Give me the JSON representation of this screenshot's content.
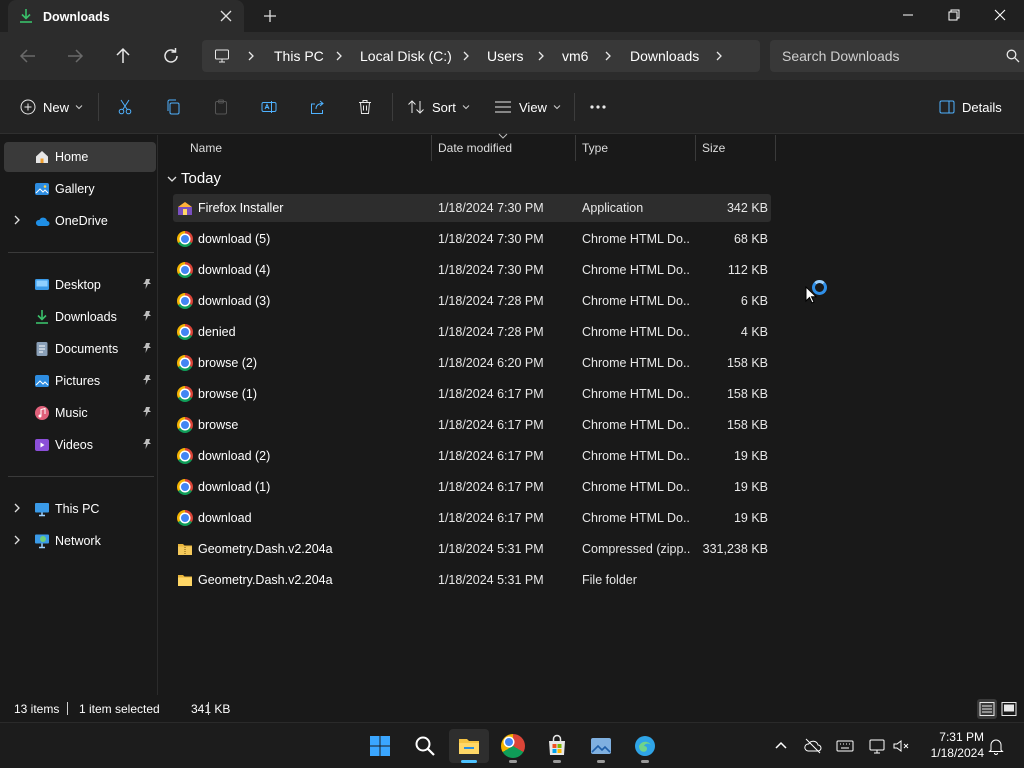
{
  "window": {
    "tab_title": "Downloads",
    "icons": {
      "tab": "download-icon",
      "close_tab": "close-icon",
      "new_tab": "plus-icon",
      "minimize": "minimize-icon",
      "maximize": "restore-icon",
      "close": "close-icon"
    }
  },
  "address": {
    "breadcrumbs": [
      "This PC",
      "Local Disk (C:)",
      "Users",
      "vm6",
      "Downloads"
    ],
    "search_placeholder": "Search Downloads",
    "nav_icons": [
      "back-arrow-icon",
      "forward-arrow-icon",
      "up-arrow-icon",
      "refresh-icon"
    ]
  },
  "commandbar": {
    "new_label": "New",
    "sort_label": "Sort",
    "view_label": "View",
    "details_label": "Details",
    "icons": [
      "new-icon",
      "cut-icon",
      "copy-icon",
      "paste-icon",
      "rename-icon",
      "share-icon",
      "delete-icon",
      "sort-icon",
      "view-icon",
      "more-icon",
      "details-pane-icon"
    ]
  },
  "sidebar": {
    "items": [
      {
        "label": "Home",
        "icon": "home-icon"
      },
      {
        "label": "Gallery",
        "icon": "gallery-icon"
      },
      {
        "label": "OneDrive",
        "icon": "cloud-icon"
      },
      {
        "label": "Desktop",
        "icon": "desktop-icon"
      },
      {
        "label": "Downloads",
        "icon": "download-icon"
      },
      {
        "label": "Documents",
        "icon": "documents-icon"
      },
      {
        "label": "Pictures",
        "icon": "pictures-icon"
      },
      {
        "label": "Music",
        "icon": "music-icon"
      },
      {
        "label": "Videos",
        "icon": "videos-icon"
      },
      {
        "label": "This PC",
        "icon": "computer-icon"
      },
      {
        "label": "Network",
        "icon": "network-icon"
      }
    ],
    "selected": "Home"
  },
  "list": {
    "columns": [
      "Name",
      "Date modified",
      "Type",
      "Size"
    ],
    "group": "Today",
    "files": [
      {
        "name": "Firefox Installer",
        "date": "1/18/2024 7:30 PM",
        "type": "Application",
        "size": "342 KB",
        "icon": "firefox-installer-icon",
        "selected": true
      },
      {
        "name": "download (5)",
        "date": "1/18/2024 7:30 PM",
        "type": "Chrome HTML Do...",
        "size": "68 KB",
        "icon": "chrome-icon"
      },
      {
        "name": "download (4)",
        "date": "1/18/2024 7:30 PM",
        "type": "Chrome HTML Do...",
        "size": "112 KB",
        "icon": "chrome-icon"
      },
      {
        "name": "download (3)",
        "date": "1/18/2024 7:28 PM",
        "type": "Chrome HTML Do...",
        "size": "6 KB",
        "icon": "chrome-icon"
      },
      {
        "name": "denied",
        "date": "1/18/2024 7:28 PM",
        "type": "Chrome HTML Do...",
        "size": "4 KB",
        "icon": "chrome-icon"
      },
      {
        "name": "browse (2)",
        "date": "1/18/2024 6:20 PM",
        "type": "Chrome HTML Do...",
        "size": "158 KB",
        "icon": "chrome-icon"
      },
      {
        "name": "browse (1)",
        "date": "1/18/2024 6:17 PM",
        "type": "Chrome HTML Do...",
        "size": "158 KB",
        "icon": "chrome-icon"
      },
      {
        "name": "browse",
        "date": "1/18/2024 6:17 PM",
        "type": "Chrome HTML Do...",
        "size": "158 KB",
        "icon": "chrome-icon"
      },
      {
        "name": "download (2)",
        "date": "1/18/2024 6:17 PM",
        "type": "Chrome HTML Do...",
        "size": "19 KB",
        "icon": "chrome-icon"
      },
      {
        "name": "download (1)",
        "date": "1/18/2024 6:17 PM",
        "type": "Chrome HTML Do...",
        "size": "19 KB",
        "icon": "chrome-icon"
      },
      {
        "name": "download",
        "date": "1/18/2024 6:17 PM",
        "type": "Chrome HTML Do...",
        "size": "19 KB",
        "icon": "chrome-icon"
      },
      {
        "name": "Geometry.Dash.v2.204a",
        "date": "1/18/2024 5:31 PM",
        "type": "Compressed (zipp...",
        "size": "331,238 KB",
        "icon": "zip-folder-icon"
      },
      {
        "name": "Geometry.Dash.v2.204a",
        "date": "1/18/2024 5:31 PM",
        "type": "File folder",
        "size": "",
        "icon": "folder-icon"
      }
    ]
  },
  "status": {
    "item_count": "13 items",
    "selection": "1 item selected",
    "selection_size": "341 KB"
  },
  "taskbar": {
    "apps": [
      "start-icon",
      "search-icon",
      "file-explorer-icon",
      "chrome-icon",
      "microsoft-store-icon",
      "photos-icon",
      "firefox-setup-icon"
    ],
    "tray_icons": [
      "chevron-up-icon",
      "onedrive-icon",
      "keyboard-icon",
      "network-icon",
      "volume-muted-icon",
      "notification-bell-icon"
    ],
    "time": "7:31 PM",
    "date": "1/18/2024"
  },
  "colors": {
    "background": "#191919",
    "toolbar": "#2c2c2c",
    "accent": "#4cc2ff",
    "selection": "#2d2d2d"
  }
}
